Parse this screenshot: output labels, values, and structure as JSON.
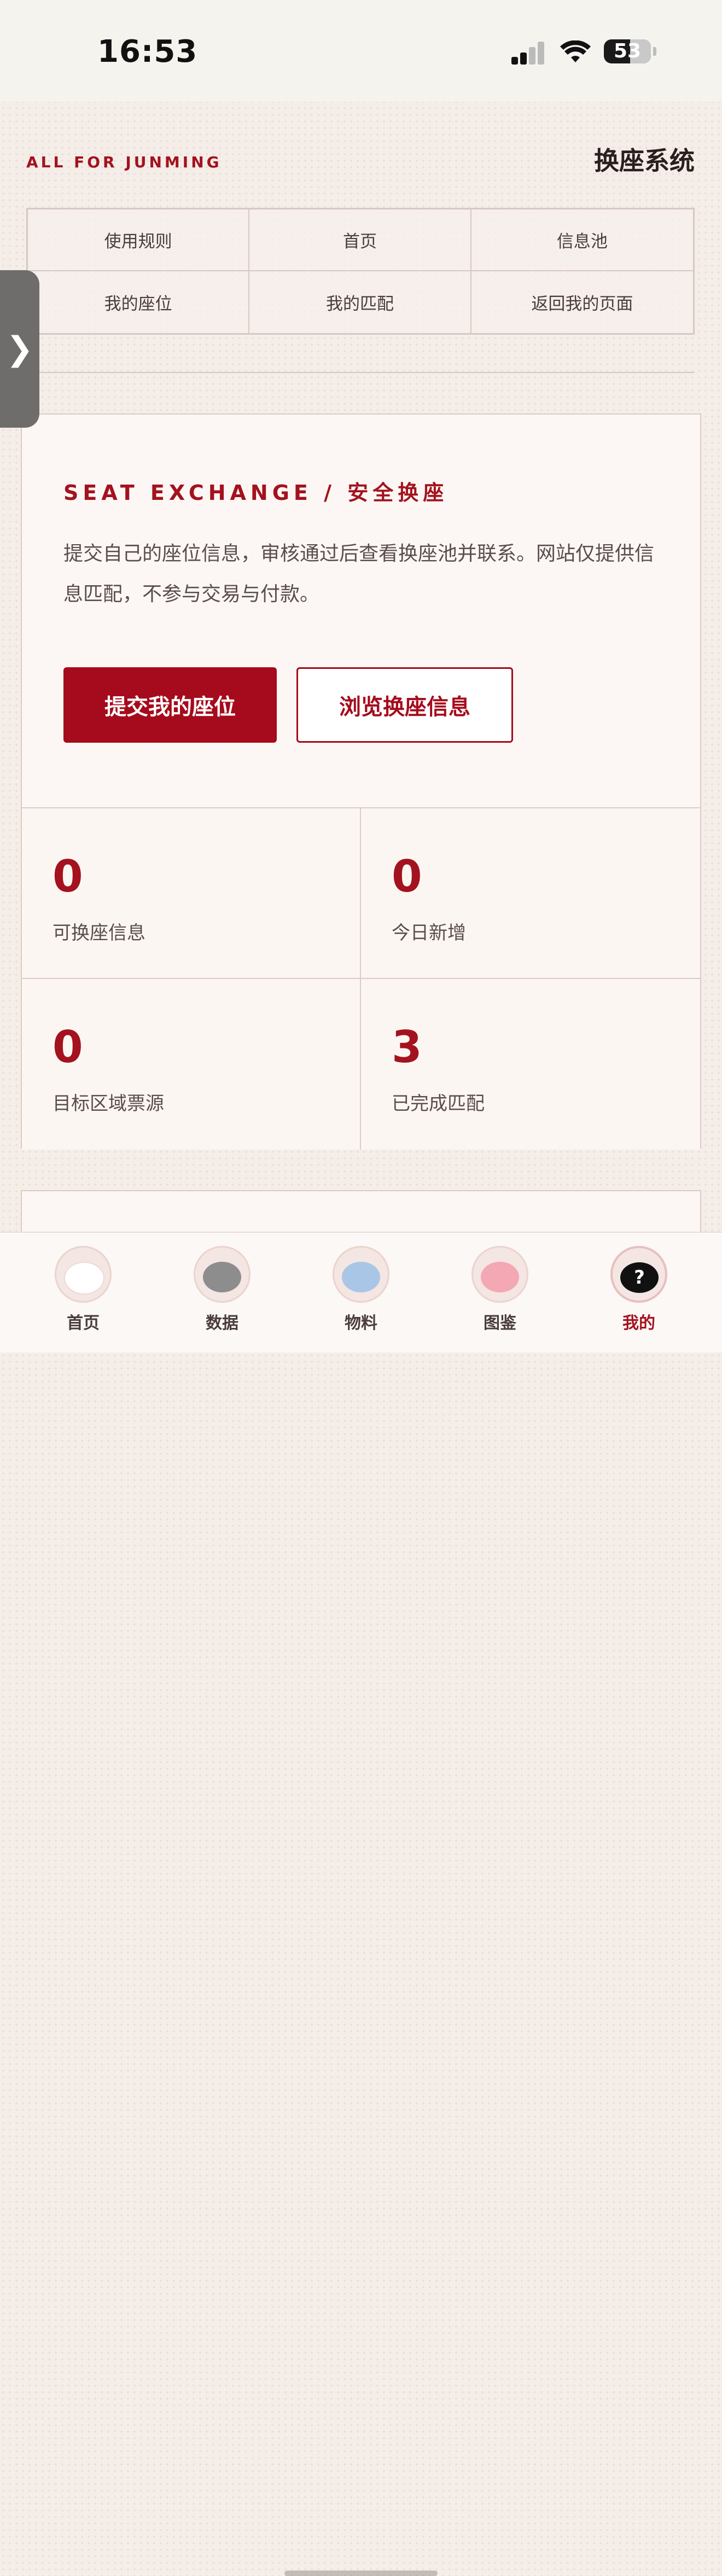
{
  "status": {
    "time": "16:53",
    "battery": "53"
  },
  "header": {
    "brand": "ALL FOR JUNMING",
    "title": "换座系统"
  },
  "nav": [
    "使用规则",
    "首页",
    "信息池",
    "我的座位",
    "我的匹配",
    "返回我的页面"
  ],
  "side_handle": "❯",
  "card": {
    "kicker": "SEAT EXCHANGE / 安全换座",
    "description": "提交自己的座位信息，审核通过后查看换座池并联系。网站仅提供信息匹配，不参与交易与付款。",
    "primary_button": "提交我的座位",
    "secondary_button": "浏览换座信息"
  },
  "stats": [
    {
      "value": "0",
      "label": "可换座信息"
    },
    {
      "value": "0",
      "label": "今日新增"
    },
    {
      "value": "0",
      "label": "目标区域票源"
    },
    {
      "value": "3",
      "label": "已完成匹配"
    }
  ],
  "tabs": [
    {
      "label": "首页",
      "icon": "white-mascot-icon"
    },
    {
      "label": "数据",
      "icon": "gray-mascot-icon"
    },
    {
      "label": "物料",
      "icon": "blue-mascot-icon"
    },
    {
      "label": "图鉴",
      "icon": "pink-mascot-icon"
    },
    {
      "label": "我的",
      "icon": "question-mascot-icon",
      "active": true
    }
  ],
  "colors": {
    "accent": "#a3121e",
    "button": "#a50b1c",
    "background": "#f4ede8"
  }
}
